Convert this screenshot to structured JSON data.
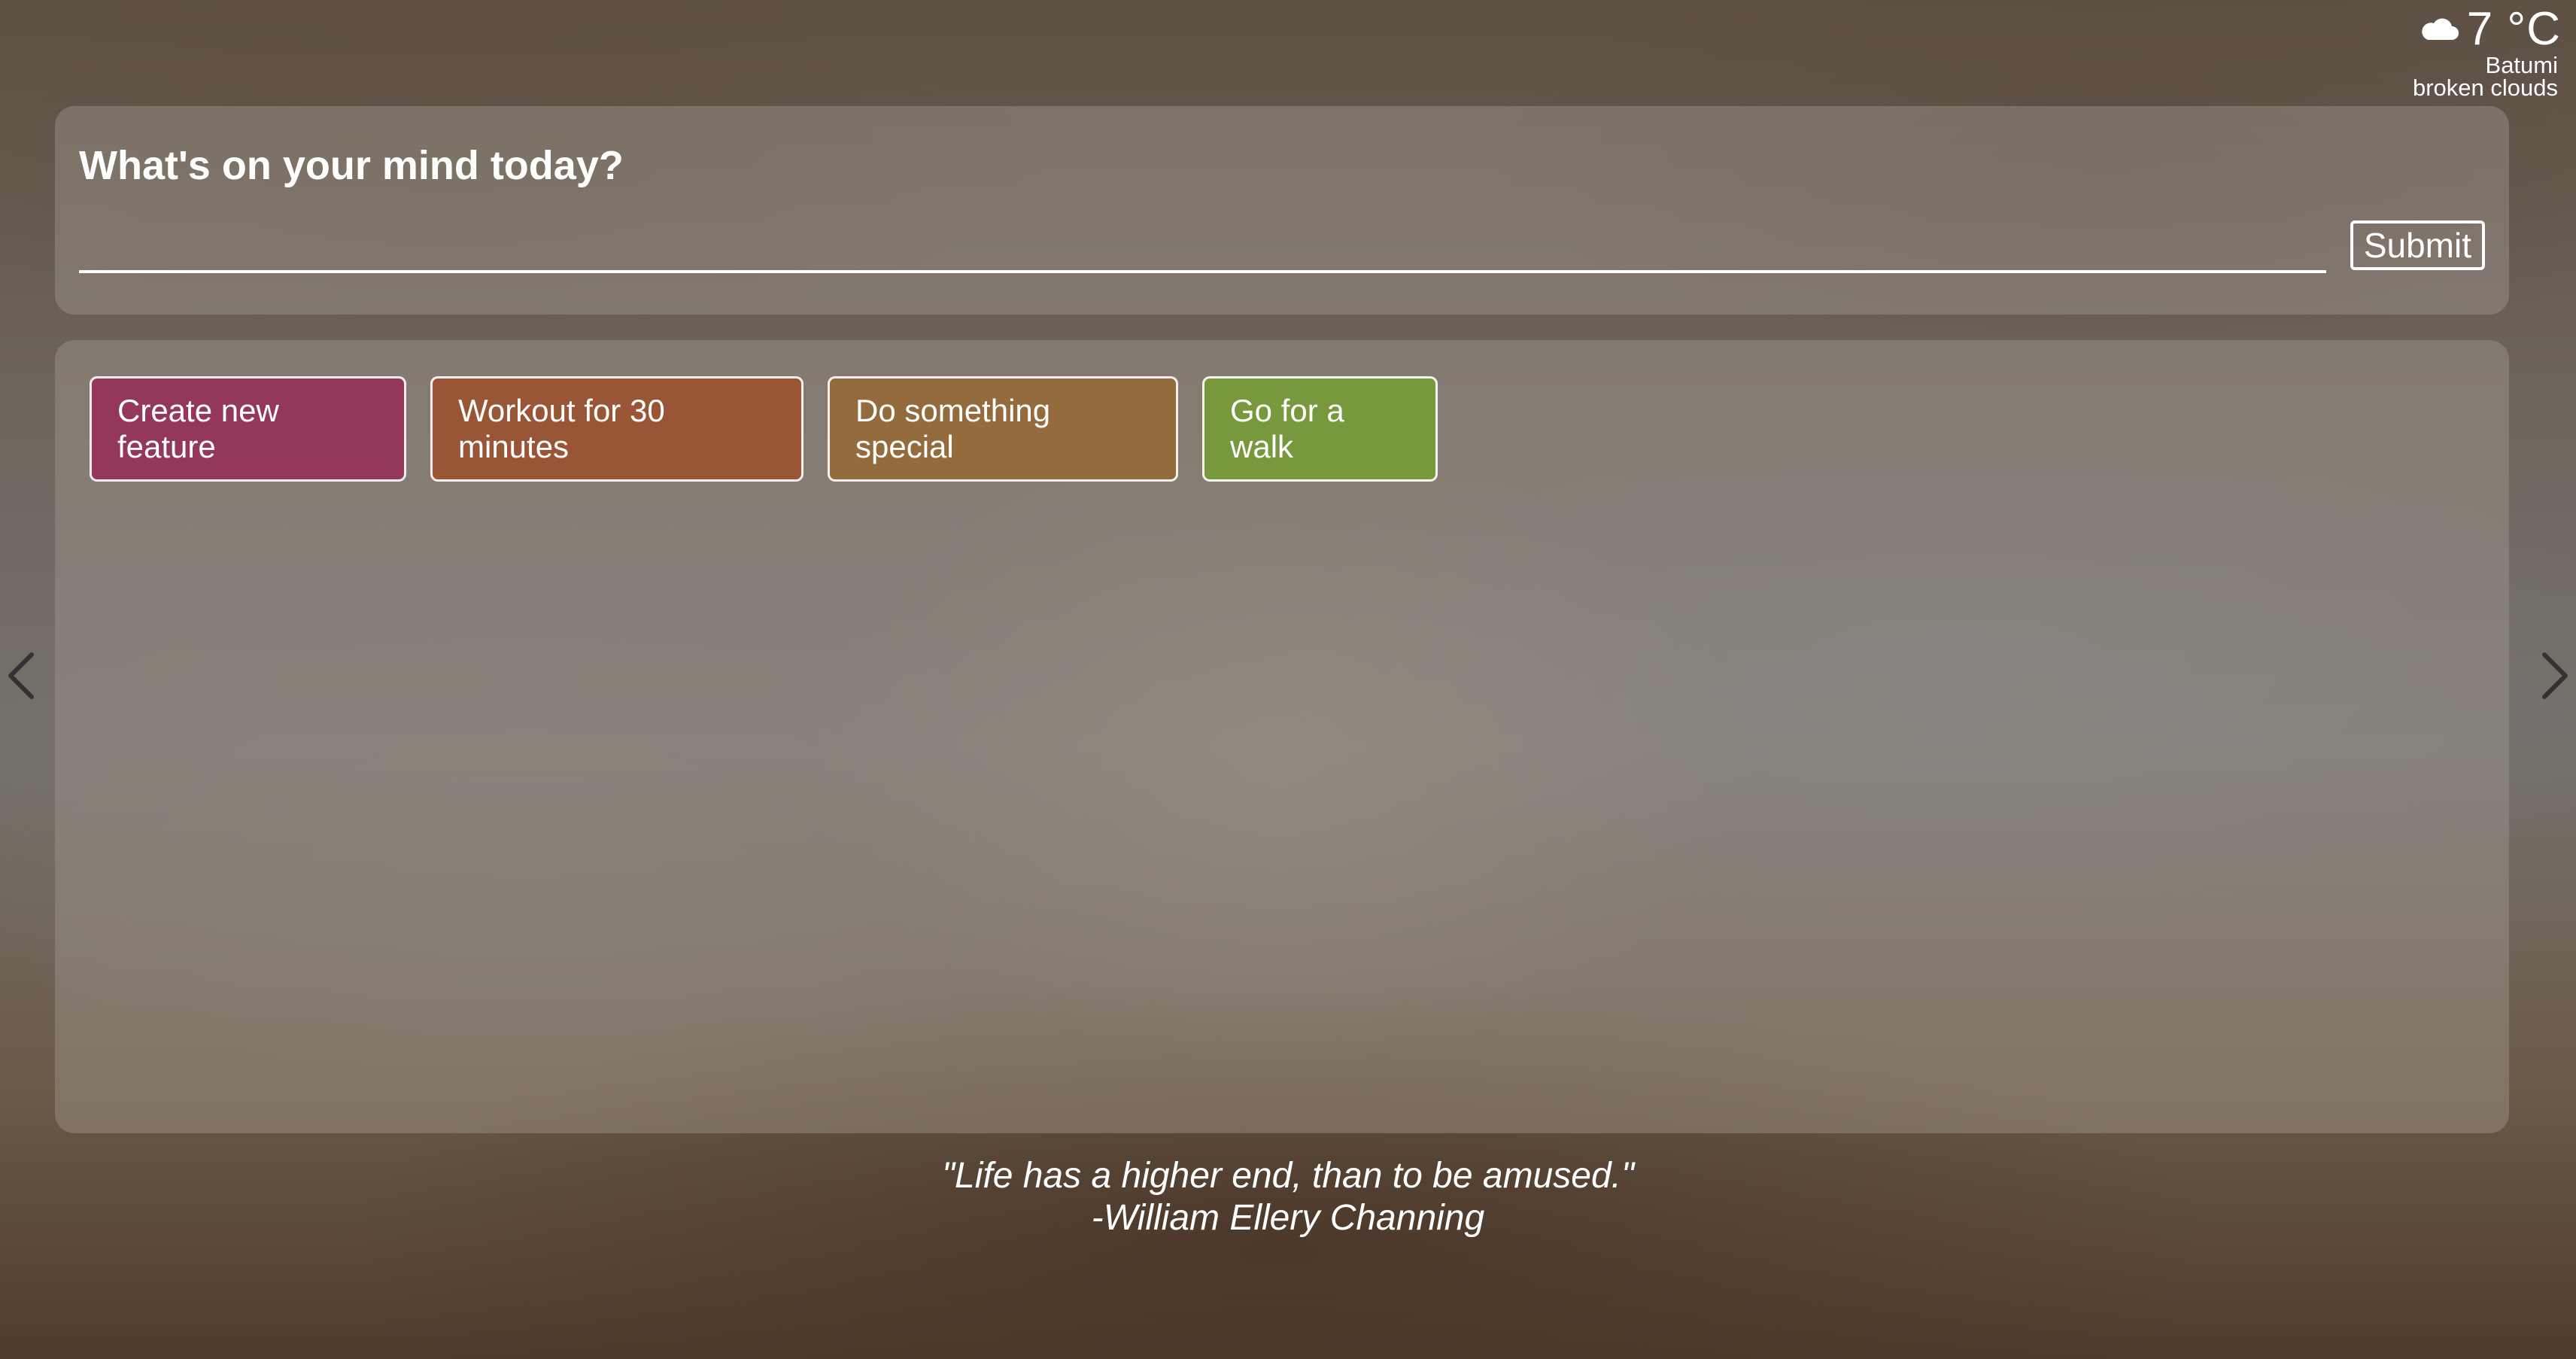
{
  "weather": {
    "icon": "cloud-icon",
    "temperature": "7 °C",
    "city": "Batumi",
    "description": "broken clouds"
  },
  "prompt": {
    "title": "What's on your mind today?",
    "input_value": "",
    "submit_label": "Submit"
  },
  "tasks": [
    {
      "label": "Create new feature",
      "color": "#93385a"
    },
    {
      "label": "Workout for 30 minutes",
      "color": "#985636"
    },
    {
      "label": "Do something special",
      "color": "#946b3c"
    },
    {
      "label": "Go for a walk",
      "color": "#77983d"
    }
  ],
  "navigation": {
    "prev_icon": "chevron-left-icon",
    "next_icon": "chevron-right-icon"
  },
  "quote": {
    "text": "\"Life has a higher end, than to be amused.\"",
    "author": "-William Ellery Channing"
  }
}
